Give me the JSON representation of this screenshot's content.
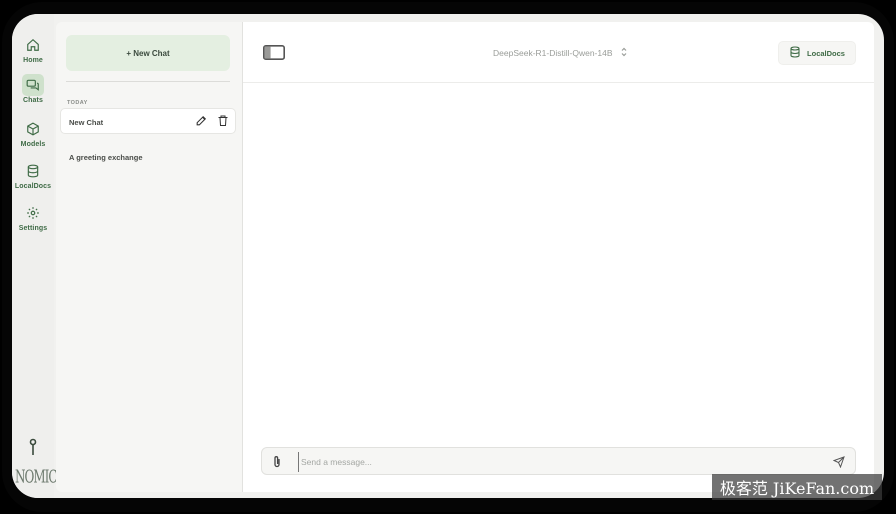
{
  "rail": {
    "items": [
      {
        "label": "Home",
        "icon": "home-icon"
      },
      {
        "label": "Chats",
        "icon": "chats-icon",
        "active": true
      },
      {
        "label": "Models",
        "icon": "cube-icon"
      },
      {
        "label": "LocalDocs",
        "icon": "database-icon"
      },
      {
        "label": "Settings",
        "icon": "gear-icon"
      }
    ],
    "logo_text": "NOMIC"
  },
  "sidebar": {
    "new_chat_label": "+ New Chat",
    "section_label": "TODAY",
    "chats": [
      {
        "title": "New Chat",
        "selected": true
      },
      {
        "title": "A greeting exchange",
        "selected": false
      }
    ]
  },
  "header": {
    "model_name": "DeepSeek-R1-Distill-Qwen-14B",
    "localdocs_label": "LocalDocs"
  },
  "composer": {
    "placeholder": "Send a message...",
    "value": ""
  },
  "watermark": "极客范 JiKeFan.com",
  "colors": {
    "accent": "#3f6b46",
    "accent_light": "#e4efe1",
    "rail_active": "#cfe1cc"
  }
}
